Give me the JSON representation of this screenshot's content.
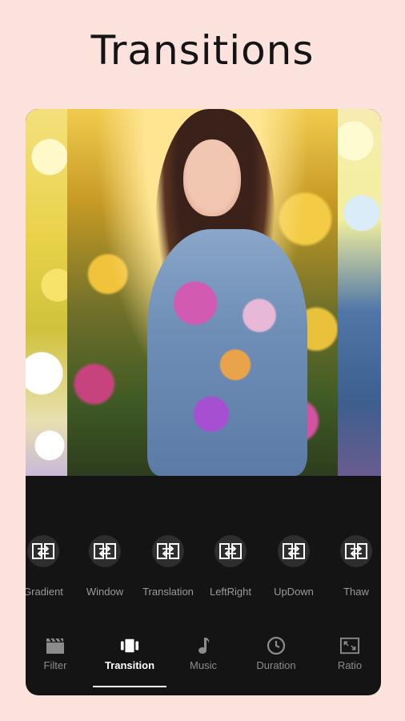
{
  "headline": "Transitions",
  "transitions": [
    {
      "label": "Gradient",
      "icon": "transition-swap-icon"
    },
    {
      "label": "Window",
      "icon": "transition-swap-icon"
    },
    {
      "label": "Translation",
      "icon": "transition-swap-icon"
    },
    {
      "label": "LeftRight",
      "icon": "transition-swap-icon"
    },
    {
      "label": "UpDown",
      "icon": "transition-swap-icon"
    },
    {
      "label": "Thaw",
      "icon": "transition-swap-icon"
    }
  ],
  "nav": [
    {
      "label": "Filter",
      "icon": "clapperboard-icon",
      "active": false
    },
    {
      "label": "Transition",
      "icon": "transition-icon",
      "active": true
    },
    {
      "label": "Music",
      "icon": "music-note-icon",
      "active": false
    },
    {
      "label": "Duration",
      "icon": "clock-icon",
      "active": false
    },
    {
      "label": "Ratio",
      "icon": "aspect-ratio-icon",
      "active": false
    }
  ],
  "colors": {
    "background": "#fce2dc",
    "panel": "#141414",
    "active_text": "#ffffff",
    "inactive_text": "#8c8c8c"
  }
}
